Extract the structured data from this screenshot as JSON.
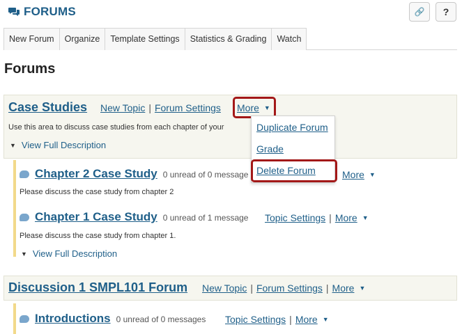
{
  "header": {
    "title": "FORUMS",
    "link_button": "🔗",
    "help_button": "?"
  },
  "tabs": [
    {
      "label": "New Forum"
    },
    {
      "label": "Organize"
    },
    {
      "label": "Template Settings"
    },
    {
      "label": "Statistics & Grading"
    },
    {
      "label": "Watch"
    }
  ],
  "page_title": "Forums",
  "forums": [
    {
      "name": "Case Studies",
      "actions": {
        "new_topic": "New Topic",
        "separator": "|",
        "forum_settings": "Forum Settings",
        "more": "More"
      },
      "description": "Use this area to discuss case studies from each chapter of your",
      "view_full": "View Full Description",
      "topics": [
        {
          "name": "Chapter 2 Case Study",
          "unread": "0 unread of 0 message",
          "more": "More",
          "description": "Please discuss the case study from chapter 2"
        },
        {
          "name": "Chapter 1 Case Study",
          "unread": "0 unread of 1 message",
          "topic_settings": "Topic Settings",
          "separator": "|",
          "more": "More",
          "description": "Please discuss the case study from chapter 1.",
          "view_full": "View Full Description"
        }
      ]
    },
    {
      "name": "Discussion 1 SMPL101 Forum",
      "actions": {
        "new_topic": "New Topic",
        "separator": "|",
        "forum_settings": "Forum Settings",
        "separator2": "|",
        "more": "More"
      },
      "topics": [
        {
          "name": "Introductions",
          "unread": "0 unread of 0 messages",
          "topic_settings": "Topic Settings",
          "separator": "|",
          "more": "More"
        }
      ]
    }
  ],
  "more_menu": {
    "items": [
      {
        "label": "Duplicate Forum"
      },
      {
        "label": "Grade"
      },
      {
        "label": "Delete Forum"
      }
    ]
  },
  "colors": {
    "link": "#1f5f89",
    "highlight": "#a31818",
    "topic_bar": "#f2d98a",
    "forum_bg": "#f6f6ef"
  }
}
